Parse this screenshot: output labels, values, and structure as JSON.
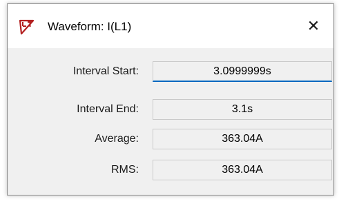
{
  "window": {
    "title": "Waveform: I(L1)",
    "close_glyph": "✕"
  },
  "fields": [
    {
      "label": "Interval Start:",
      "value": "3.0999999s"
    },
    {
      "label": "Interval End:",
      "value": "3.1s"
    },
    {
      "label": "Average:",
      "value": "363.04A"
    },
    {
      "label": "RMS:",
      "value": "363.04A"
    }
  ],
  "colors": {
    "accent": "#0067c0",
    "icon_red": "#b32020"
  }
}
